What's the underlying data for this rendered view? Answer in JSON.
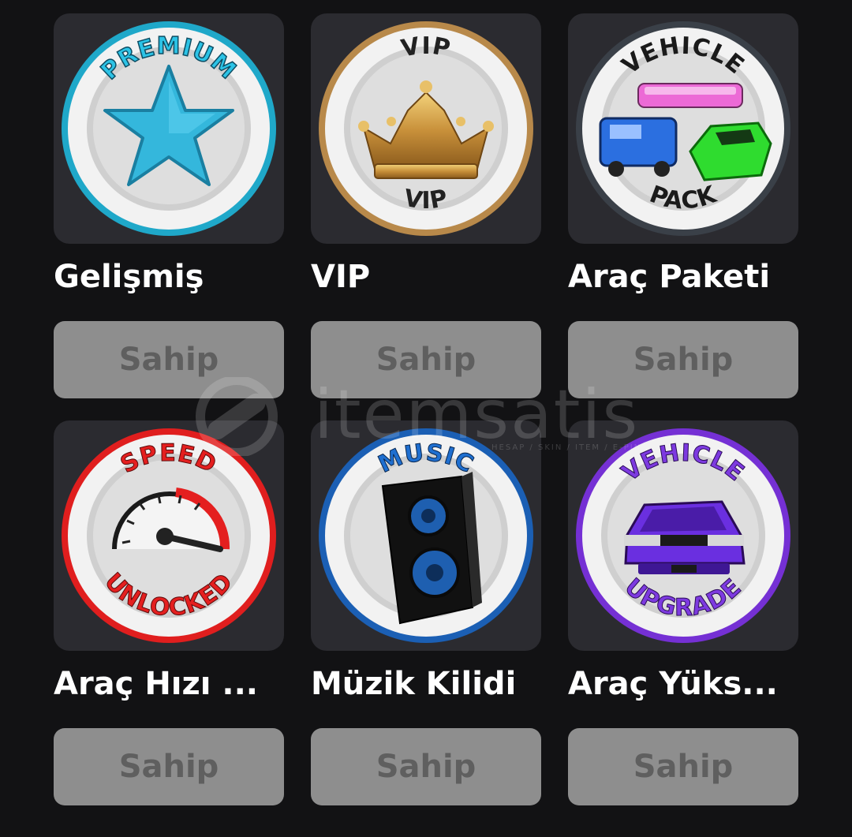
{
  "watermark": {
    "text": "itemsatis",
    "subtext": "HESAP / SKIN / ITEM / E-PIN"
  },
  "items": [
    {
      "title": "Gelişmiş",
      "button_label": "Sahip",
      "icon": "premium-star-badge-icon",
      "badge_top": "PREMIUM",
      "badge_bottom": "",
      "accent": "#29b6d6"
    },
    {
      "title": "VIP",
      "button_label": "Sahip",
      "icon": "vip-crown-badge-icon",
      "badge_top": "VIP",
      "badge_bottom": "VIP",
      "accent": "#c8964a"
    },
    {
      "title": "Araç Paketi",
      "button_label": "Sahip",
      "icon": "vehicle-pack-badge-icon",
      "badge_top": "VEHICLE",
      "badge_bottom": "PACK",
      "accent": "#404852"
    },
    {
      "title": "Araç Hızı ...",
      "button_label": "Sahip",
      "icon": "speed-unlocked-badge-icon",
      "badge_top": "SPEED",
      "badge_bottom": "UNLOCKED",
      "accent": "#e62020"
    },
    {
      "title": "Müzik Kilidi",
      "button_label": "Sahip",
      "icon": "music-speaker-badge-icon",
      "badge_top": "MUSIC",
      "badge_bottom": "",
      "accent": "#1f63b8"
    },
    {
      "title": "Araç Yüks...",
      "button_label": "Sahip",
      "icon": "vehicle-upgrade-badge-icon",
      "badge_top": "VEHICLE",
      "badge_bottom": "UPGRADE",
      "accent": "#7a32d8"
    }
  ]
}
